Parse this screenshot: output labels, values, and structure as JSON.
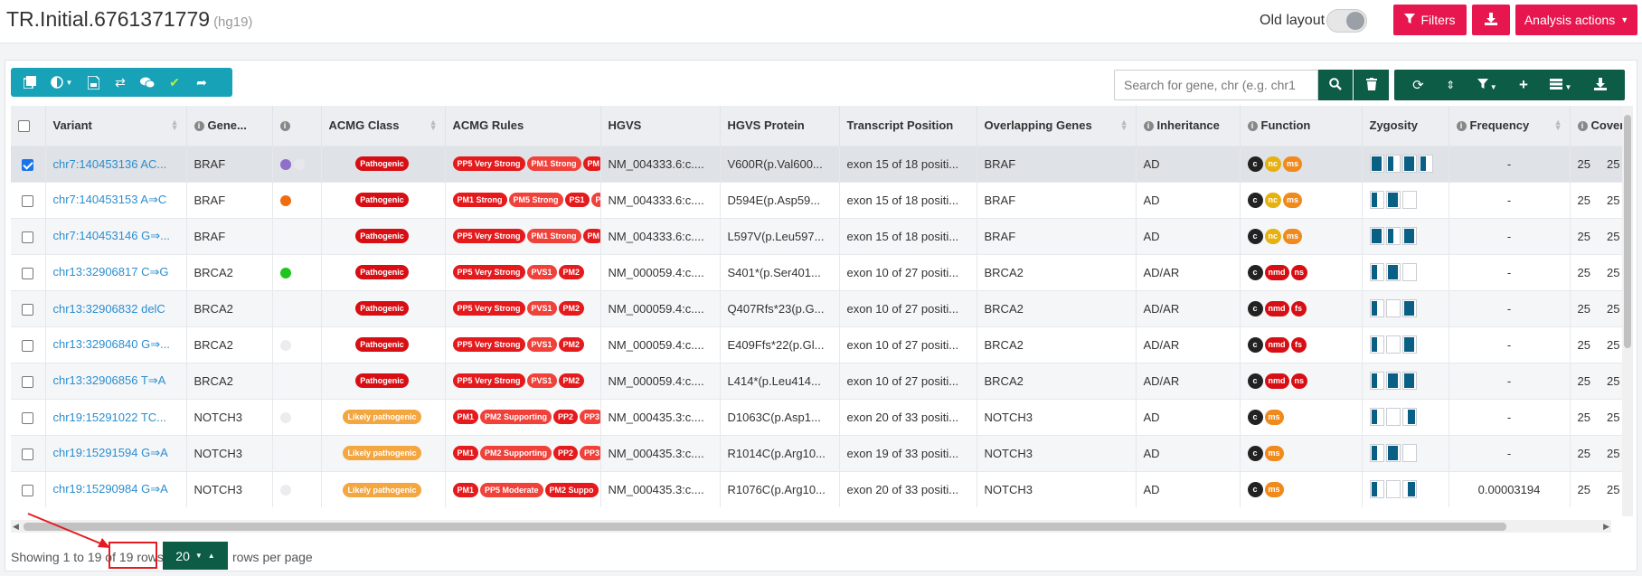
{
  "header": {
    "title": "TR.Initial.6761371779",
    "build": "(hg19)",
    "old_layout_label": "Old layout",
    "filters_label": "Filters",
    "analysis_actions_label": "Analysis actions"
  },
  "search": {
    "placeholder": "Search for gene, chr (e.g. chr1"
  },
  "columns": [
    "Variant",
    "Gene...",
    "",
    "ACMG Class",
    "ACMG Rules",
    "HGVS",
    "HGVS Protein",
    "Transcript Position",
    "Overlapping Genes",
    "Inheritance",
    "Function",
    "Zygosity",
    "Frequency",
    "Covera"
  ],
  "rows": [
    {
      "variant": "chr7:140453136 AC...",
      "gene": "BRAF",
      "dots": [
        "#8e6fc9",
        "#e8e8ec"
      ],
      "acmg": "Pathogenic",
      "acmg_type": "path",
      "rules": [
        "PP5 Very Strong",
        "PM1 Strong",
        "PM"
      ],
      "hgvs": "NM_004333.6:c....",
      "protein": "V600R(p.Val600...",
      "tpos": "exon 15 of 18 positi...",
      "ogenes": "BRAF",
      "inh": "AD",
      "fn": [
        "c",
        "nc",
        "ms"
      ],
      "zyg": [
        "full",
        "half",
        "full",
        "half"
      ],
      "freq": "-",
      "cov1": "25",
      "cov2": "25",
      "checked": true
    },
    {
      "variant": "chr7:140453153 A⇒C",
      "gene": "BRAF",
      "dots": [
        "#f06d0f"
      ],
      "acmg": "Pathogenic",
      "acmg_type": "path",
      "rules": [
        "PM1 Strong",
        "PM5 Strong",
        "PS1",
        "P"
      ],
      "hgvs": "NM_004333.6:c....",
      "protein": "D594E(p.Asp59...",
      "tpos": "exon 15 of 18 positi...",
      "ogenes": "BRAF",
      "inh": "AD",
      "fn": [
        "c",
        "nc",
        "ms"
      ],
      "zyg": [
        "half",
        "full",
        "empty"
      ],
      "freq": "-",
      "cov1": "25",
      "cov2": "25",
      "checked": false
    },
    {
      "variant": "chr7:140453146 G⇒...",
      "gene": "BRAF",
      "dots": [],
      "acmg": "Pathogenic",
      "acmg_type": "path",
      "rules": [
        "PP5 Very Strong",
        "PM1 Strong",
        "PM"
      ],
      "hgvs": "NM_004333.6:c....",
      "protein": "L597V(p.Leu597...",
      "tpos": "exon 15 of 18 positi...",
      "ogenes": "BRAF",
      "inh": "AD",
      "fn": [
        "c",
        "nc",
        "ms"
      ],
      "zyg": [
        "full",
        "half",
        "full"
      ],
      "freq": "-",
      "cov1": "25",
      "cov2": "25",
      "checked": false
    },
    {
      "variant": "chr13:32906817 C⇒G",
      "gene": "BRCA2",
      "dots": [
        "#1fc41f"
      ],
      "acmg": "Pathogenic",
      "acmg_type": "path",
      "rules": [
        "PP5 Very Strong",
        "PVS1",
        "PM2"
      ],
      "hgvs": "NM_000059.4:c....",
      "protein": "S401*(p.Ser401...",
      "tpos": "exon 10 of 27 positi...",
      "ogenes": "BRCA2",
      "inh": "AD/AR",
      "fn": [
        "c",
        "nmd",
        "ns"
      ],
      "zyg": [
        "half",
        "full",
        "empty"
      ],
      "freq": "-",
      "cov1": "25",
      "cov2": "25",
      "checked": false
    },
    {
      "variant": "chr13:32906832 delC",
      "gene": "BRCA2",
      "dots": [],
      "acmg": "Pathogenic",
      "acmg_type": "path",
      "rules": [
        "PP5 Very Strong",
        "PVS1",
        "PM2"
      ],
      "hgvs": "NM_000059.4:c....",
      "protein": "Q407Rfs*23(p.G...",
      "tpos": "exon 10 of 27 positi...",
      "ogenes": "BRCA2",
      "inh": "AD/AR",
      "fn": [
        "c",
        "nmd",
        "fs"
      ],
      "zyg": [
        "half",
        "empty",
        "full"
      ],
      "freq": "-",
      "cov1": "25",
      "cov2": "25",
      "checked": false
    },
    {
      "variant": "chr13:32906840 G⇒...",
      "gene": "BRCA2",
      "dots": [
        "#ececef"
      ],
      "acmg": "Pathogenic",
      "acmg_type": "path",
      "rules": [
        "PP5 Very Strong",
        "PVS1",
        "PM2"
      ],
      "hgvs": "NM_000059.4:c....",
      "protein": "E409Ffs*22(p.Gl...",
      "tpos": "exon 10 of 27 positi...",
      "ogenes": "BRCA2",
      "inh": "AD/AR",
      "fn": [
        "c",
        "nmd",
        "fs"
      ],
      "zyg": [
        "half",
        "empty",
        "full"
      ],
      "freq": "-",
      "cov1": "25",
      "cov2": "25",
      "checked": false
    },
    {
      "variant": "chr13:32906856 T⇒A",
      "gene": "BRCA2",
      "dots": [],
      "acmg": "Pathogenic",
      "acmg_type": "path",
      "rules": [
        "PP5 Very Strong",
        "PVS1",
        "PM2"
      ],
      "hgvs": "NM_000059.4:c....",
      "protein": "L414*(p.Leu414...",
      "tpos": "exon 10 of 27 positi...",
      "ogenes": "BRCA2",
      "inh": "AD/AR",
      "fn": [
        "c",
        "nmd",
        "ns"
      ],
      "zyg": [
        "half",
        "full",
        "full"
      ],
      "freq": "-",
      "cov1": "25",
      "cov2": "25",
      "checked": false
    },
    {
      "variant": "chr19:15291022 TC...",
      "gene": "NOTCH3",
      "dots": [
        "#ececef"
      ],
      "acmg": "Likely pathogenic",
      "acmg_type": "lpath",
      "rules": [
        "PM1",
        "PM2 Supporting",
        "PP2",
        "PP3"
      ],
      "hgvs": "NM_000435.3:c....",
      "protein": "D1063C(p.Asp1...",
      "tpos": "exon 20 of 33 positi...",
      "ogenes": "NOTCH3",
      "inh": "AD",
      "fn": [
        "c",
        "ms"
      ],
      "zyg": [
        "half",
        "empty",
        "right"
      ],
      "freq": "-",
      "cov1": "25",
      "cov2": "25",
      "checked": false
    },
    {
      "variant": "chr19:15291594 G⇒A",
      "gene": "NOTCH3",
      "dots": [],
      "acmg": "Likely pathogenic",
      "acmg_type": "lpath",
      "rules": [
        "PM1",
        "PM2 Supporting",
        "PP2",
        "PP3"
      ],
      "hgvs": "NM_000435.3:c....",
      "protein": "R1014C(p.Arg10...",
      "tpos": "exon 19 of 33 positi...",
      "ogenes": "NOTCH3",
      "inh": "AD",
      "fn": [
        "c",
        "ms"
      ],
      "zyg": [
        "half",
        "full",
        "empty"
      ],
      "freq": "-",
      "cov1": "25",
      "cov2": "25",
      "checked": false
    },
    {
      "variant": "chr19:15290984 G⇒A",
      "gene": "NOTCH3",
      "dots": [
        "#ececef"
      ],
      "acmg": "Likely pathogenic",
      "acmg_type": "lpath",
      "rules": [
        "PM1",
        "PP5 Moderate",
        "PM2 Suppo"
      ],
      "hgvs": "NM_000435.3:c....",
      "protein": "R1076C(p.Arg10...",
      "tpos": "exon 20 of 33 positi...",
      "ogenes": "NOTCH3",
      "inh": "AD",
      "fn": [
        "c",
        "ms"
      ],
      "zyg": [
        "half",
        "empty",
        "right"
      ],
      "freq": "0.00003194",
      "cov1": "25",
      "cov2": "25",
      "checked": false
    }
  ],
  "footer": {
    "showing_prefix": "Showing 1 to 19 of ",
    "total_rows": "19 rows",
    "page_size": "20",
    "rows_per_page": "rows per page"
  }
}
